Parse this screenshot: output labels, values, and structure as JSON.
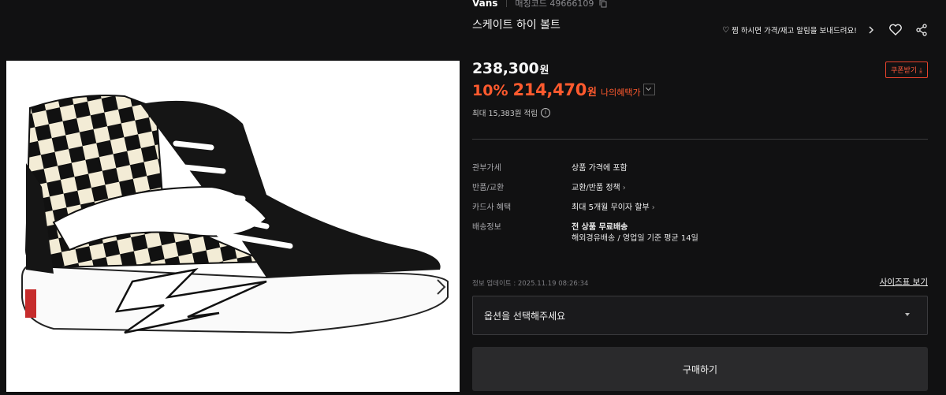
{
  "product": {
    "brand": "Vans",
    "code_label": "매칭코드",
    "code": "49666109",
    "title": "스케이트 하이 볼트"
  },
  "actions": {
    "alert_text": "찜 하시면 가격/재고 알림을 보내드려요!",
    "alert_icon": "heart-outline-icon",
    "wishlist_icon": "heart-icon",
    "share_icon": "share-icon"
  },
  "pricing": {
    "original_price": "238,300",
    "currency": "원",
    "coupon_label": "쿠폰받기",
    "discount_rate": "10%",
    "sale_price": "214,470",
    "my_benefit_label": "나의혜택가",
    "points_text": "최대 15,383원 적립",
    "accent_color": "#ff5a2e"
  },
  "details": [
    {
      "key": "관부가세",
      "value": "상품 가격에 포함"
    },
    {
      "key": "반품/교환",
      "value": "교환/반품 정책"
    },
    {
      "key": "카드사 혜택",
      "value": "최대 5개월 무이자 할부"
    },
    {
      "key": "배송정보",
      "value": "전 상품 무료배송"
    }
  ],
  "shipping_sub": "해외경유배송 / 영업일 기준 평균 14일",
  "updated_text": "정보 업데이트 : 2025.11.19 08:26:34",
  "size_chart_label": "사이즈표 보기",
  "option_placeholder": "옵션을 선택해주세요",
  "buy_label": "구매하기"
}
